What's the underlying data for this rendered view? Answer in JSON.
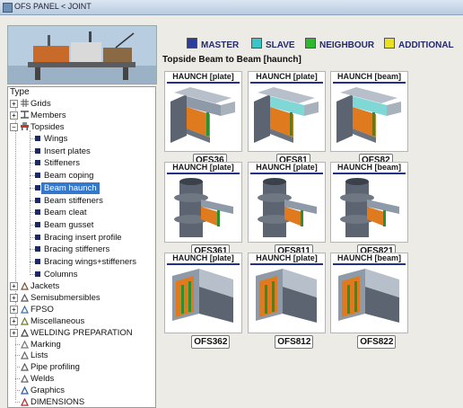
{
  "window": {
    "title": "OFS PANEL < JOINT"
  },
  "legend": [
    {
      "label": "MASTER",
      "color": "#2c3e9c"
    },
    {
      "label": "SLAVE",
      "color": "#39c6c6"
    },
    {
      "label": "NEIGHBOUR",
      "color": "#2eb82e"
    },
    {
      "label": "ADDITIONAL",
      "color": "#e8e020"
    }
  ],
  "panel_heading": "Topside Beam to Beam [haunch]",
  "tree": {
    "header": "Type",
    "top": [
      "Grids",
      "Members",
      "Topsides"
    ],
    "topsides_children": [
      "Wings",
      "Insert plates",
      "Stiffeners",
      "Beam coping",
      "Beam haunch",
      "Beam stiffeners",
      "Beam cleat",
      "Beam gusset",
      "Bracing insert profile",
      "Bracing stiffeners",
      "Bracing wings+stiffeners",
      "Columns"
    ],
    "selected": "Beam haunch",
    "rest": [
      "Jackets",
      "Semisubmersibles",
      "FPSO",
      "Miscellaneous",
      "WELDING PREPARATION",
      "Marking",
      "Lists",
      "Pipe profiling",
      "Welds",
      "Graphics",
      "DIMENSIONS"
    ]
  },
  "cards": [
    {
      "title": "HAUNCH [plate]",
      "code": "OFS36",
      "kind": "beam",
      "slave": "#8f9aa8"
    },
    {
      "title": "HAUNCH [plate]",
      "code": "OFS81",
      "kind": "beam",
      "slave": "#7fd8d6"
    },
    {
      "title": "HAUNCH [beam]",
      "code": "OFS82",
      "kind": "beam",
      "slave": "#7fd8d6"
    },
    {
      "title": "HAUNCH [plate]",
      "code": "OFS361",
      "kind": "col",
      "slave": "#8f9aa8"
    },
    {
      "title": "HAUNCH [plate]",
      "code": "OFS811",
      "kind": "col",
      "slave": "#8f9aa8"
    },
    {
      "title": "HAUNCH [beam]",
      "code": "OFS821",
      "kind": "col",
      "slave": "#8f9aa8"
    },
    {
      "title": "HAUNCH [plate]",
      "code": "OFS362",
      "kind": "box",
      "slave": "#8f9aa8"
    },
    {
      "title": "HAUNCH [plate]",
      "code": "OFS812",
      "kind": "box",
      "slave": "#8f9aa8"
    },
    {
      "title": "HAUNCH [beam]",
      "code": "OFS822",
      "kind": "box",
      "slave": "#8f9aa8"
    }
  ]
}
